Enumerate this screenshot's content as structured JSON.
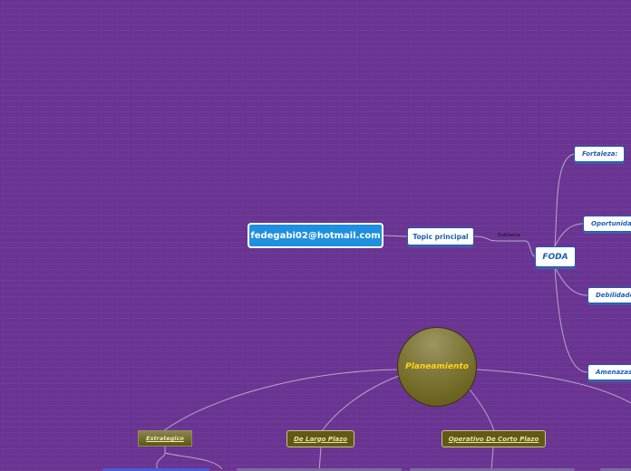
{
  "root": {
    "label": "fedegabi02@hotmail.com"
  },
  "topic": {
    "label": "Topic principal",
    "link_label": "Subtema"
  },
  "foda": {
    "label": "FODA",
    "items": [
      {
        "label": "Fortaleza:"
      },
      {
        "label": "Oportunidades"
      },
      {
        "label": "Debilidades"
      },
      {
        "label": "Amenazas"
      }
    ]
  },
  "planeamiento": {
    "label": "Planeamiento",
    "children": [
      {
        "label": "Estrategico"
      },
      {
        "label": "De Largo Plazo"
      },
      {
        "label": "Operativo De Corto Plazo"
      }
    ]
  },
  "colors": {
    "background": "#6a3592",
    "root_fill": "#1f8fe0",
    "node_text": "#1a5fb4",
    "olive": "#625a12",
    "planeamiento_text": "#ffd21a"
  }
}
